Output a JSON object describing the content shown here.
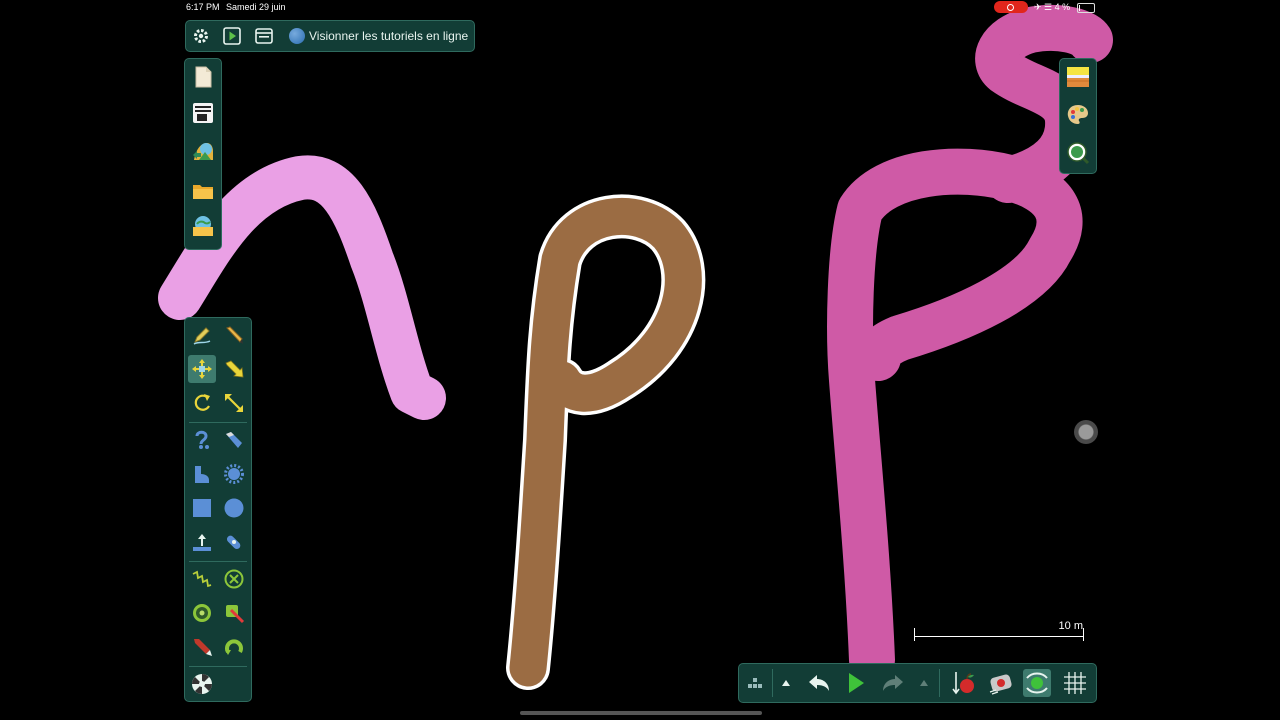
{
  "status_bar": {
    "time": "6:17 PM",
    "date": "Samedi 29 juin",
    "battery": "4 %"
  },
  "top_toolbar": {
    "settings_icon": "gear-icon",
    "play_icon": "play-icon",
    "window_icon": "window-icon",
    "tutorials_label": "Visionner les tutoriels en ligne"
  },
  "file_toolbar": {
    "items": [
      "new-document-icon",
      "scene-template-icon",
      "import-image-icon",
      "open-folder-icon",
      "open-library-icon"
    ]
  },
  "tools": {
    "items": [
      "draw-tool-icon",
      "pencil-tool-icon",
      "move-tool-icon",
      "drag-arrow-icon",
      "rotate-tool-icon",
      "resize-tool-icon",
      "rope-tool-icon",
      "knife-tool-icon",
      "polygon-tool-icon",
      "gear-shape-tool-icon",
      "box-tool-icon",
      "circle-tool-icon",
      "fixate-tool-icon",
      "hinge-tool-icon",
      "spring-tool-icon",
      "weld-tool-icon",
      "thruster-tool-icon",
      "laser-tool-icon",
      "tracer-tool-icon",
      "axle-tool-icon",
      "texture-tool-icon"
    ],
    "selected": "move-tool-icon"
  },
  "right_toolbar": {
    "items": [
      "background-icon",
      "palette-icon",
      "zoom-fit-icon"
    ]
  },
  "bottom_toolbar": {
    "items": [
      "grid-snap-icon",
      "expand-up-icon",
      "undo-icon",
      "play-icon",
      "redo-icon",
      "expand-up-icon",
      "gravity-icon",
      "air-friction-icon",
      "view-follow-icon",
      "grid-icon"
    ]
  },
  "scale": {
    "label": "10 m"
  },
  "colors": {
    "panel": "#123d36",
    "panel_border": "#2f6a5e",
    "pink_stroke": "#eaa0e5",
    "magenta_stroke": "#cf5aa6",
    "brown_stroke": "#9b6c43",
    "outline": "#ffffff"
  }
}
